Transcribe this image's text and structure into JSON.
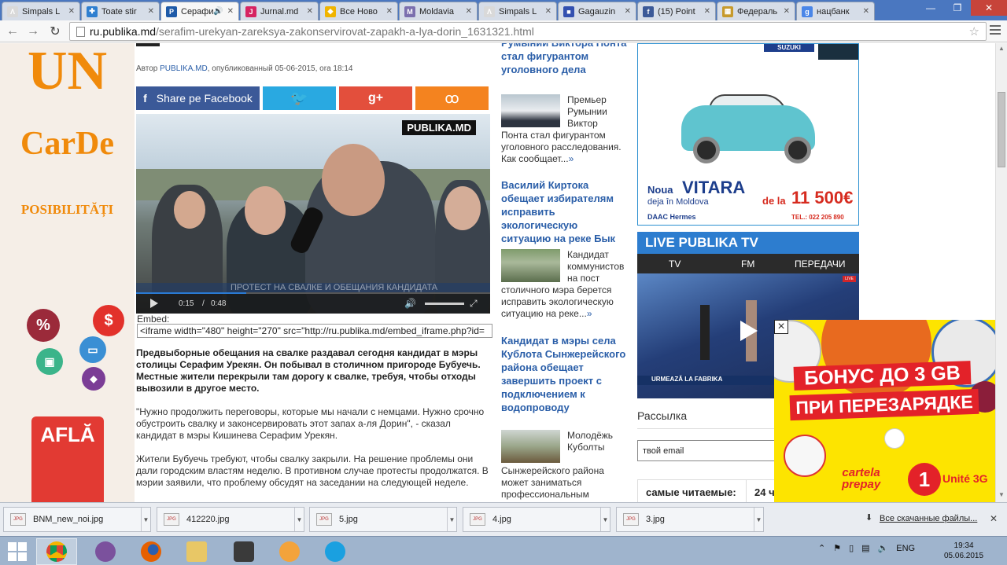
{
  "browser": {
    "tabs": [
      {
        "title": "Simpals L",
        "fav_color": "#d9d9d9",
        "fav_glyph": "Ʌ"
      },
      {
        "title": "Toate stir",
        "fav_color": "#2f7fd0",
        "fav_glyph": "✚"
      },
      {
        "title": "Серафи",
        "fav_color": "#1e5aa8",
        "fav_glyph": "P",
        "active": true
      },
      {
        "title": "Jurnal.md",
        "fav_color": "#d62462",
        "fav_glyph": "J"
      },
      {
        "title": "Все Ново",
        "fav_color": "#f0b400",
        "fav_glyph": "◆"
      },
      {
        "title": "Moldavia",
        "fav_color": "#7b6fae",
        "fav_glyph": "M"
      },
      {
        "title": "Simpals L",
        "fav_color": "#d9d9d9",
        "fav_glyph": "Ʌ"
      },
      {
        "title": "Gagauzin",
        "fav_color": "#3350b0",
        "fav_glyph": "■"
      },
      {
        "title": "(15) Point",
        "fav_color": "#3b5998",
        "fav_glyph": "f"
      },
      {
        "title": "Федераль",
        "fav_color": "#c79a2c",
        "fav_glyph": "▦"
      },
      {
        "title": "нацбанк",
        "fav_color": "#4a86e8",
        "fav_glyph": "g"
      }
    ],
    "url_host": "ru.publika.md",
    "url_path": "/serafim-urekyan-zareksya-zakonservirovat-zapakh-a-lya-dorin_1631321.html"
  },
  "left_ad": {
    "line1": "UN",
    "line2": "CarDe",
    "line3": "POSIBILITĂȚI",
    "bag_text": "AFLĂ",
    "bubble_percent": "%",
    "bubble_dollar": "$"
  },
  "article": {
    "byline_prefix": "Автор ",
    "byline_author": "PUBLIKA.MD",
    "byline_suffix": ", опубликованный 05-06-2015, ora 18:14",
    "share_facebook": "Share pe Facebook",
    "share_twitter": "🐦",
    "share_gplus": "g+",
    "share_ok": "ꝏ",
    "video": {
      "logo": "PUBLIKA.MD",
      "caption": "ПРОТЕСТ НА СВАЛКЕ И ОБЕЩАНИЯ КАНДИДАТА",
      "time_current": "0:15",
      "time_separator": "/",
      "time_total": "0:48",
      "progress": 0.31
    },
    "embed_label": "Embed:",
    "embed_code": "<iframe width=\"480\" height=\"270\" src=\"http://ru.publika.md/embed_iframe.php?id=",
    "lead": "Предвыборные обещания на свалке раздавал сегодня кандидат в мэры столицы Серафим Урекян. Он побывал в столичном пригороде Бубуечь. Местные жители перекрыли там дорогу к свалке, требуя, чтобы отходы вывозили в другое место.",
    "para1": "\"Нужно продолжить переговоры, которые мы начали с немцами. Нужно срочно обустроить свалку и законсервировать этот запах а-ля Дорин\", - сказал кандидат в мэры Кишинева Серафим Урекян.",
    "para2": "Жители Бубуечь требуют, чтобы свалку закрыли. На решение проблемы они дали городским властям неделю. В противном случае протесты продолжатся. В мэрии заявили, что проблему обсудят на заседании на следующей неделе."
  },
  "news": {
    "items": [
      {
        "title": "Румынии Виктора Понта стал фигурантом уголовного дела",
        "text": "Премьер Румынии Виктор Понта стал фигурантом уголовного расследования. Как сообщает...",
        "more": "»"
      },
      {
        "title": "Василий Киртока обещает избирателям исправить экологическую ситуацию на реке Бык",
        "text": "Кандидат коммунистов на пост столичного мэра берется исправить экологическую ситуацию на реке...",
        "more": "»"
      },
      {
        "title": "Кандидат в мэры села Кублота Сынжерейского района обещает завершить проект с подключением к водопроводу",
        "text": "Молодёжь Куболты Сынжерейского района может заниматься профессиональным",
        "more": ""
      }
    ]
  },
  "ad_car": {
    "brand": "SUZUKI",
    "noua": "Noua",
    "model": "VITARA",
    "deja": "deja în Moldova",
    "dela": "de la",
    "price": "11 500€",
    "dealer": "DAAC Hermes",
    "tel": "TEL.: 022 205 890"
  },
  "live": {
    "title": "LIVE PUBLIKA TV",
    "tab_tv": "TV",
    "tab_fm": "FM",
    "tab_shows": "ПЕРЕДАЧИ",
    "banner": "URMEAZĂ LA FABRIKA",
    "live_badge": "LIVE"
  },
  "newsletter": {
    "title": "Рассылка",
    "email_value": "твой email"
  },
  "popular": {
    "tab1": "самые читаемые:",
    "tab2": "24 ч"
  },
  "promo": {
    "line1": "БОНУС   ДО 3 GB",
    "line2": "ПРИ ПЕРЕЗАРЯДКЕ",
    "cartela": "cartela\nprepay",
    "logo_digit": "1",
    "unite": "Unité 3G",
    "close": "×"
  },
  "downloads": {
    "files": [
      "BNM_new_noi.jpg",
      "412220.jpg",
      "5.jpg",
      "4.jpg",
      "3.jpg"
    ],
    "show_all": "Все скачанные файлы...",
    "close": "✕"
  },
  "taskbar": {
    "lang": "ENG",
    "time": "19:34",
    "date": "05.06.2015"
  }
}
